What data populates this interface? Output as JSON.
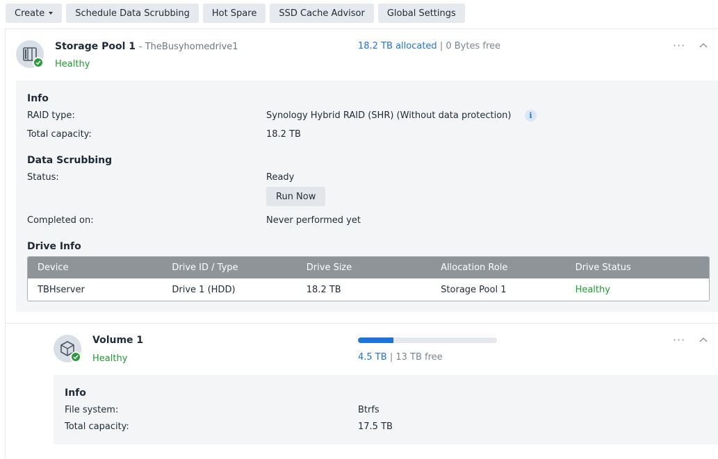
{
  "toolbar": {
    "create": "Create",
    "schedule": "Schedule Data Scrubbing",
    "hot_spare": "Hot Spare",
    "ssd_cache": "SSD Cache Advisor",
    "global_settings": "Global Settings"
  },
  "pool": {
    "name": "Storage Pool 1",
    "description": "- TheBusyhomedrive1",
    "status": "Healthy",
    "allocated": "18.2 TB allocated",
    "separator": "|",
    "free": "0 Bytes free",
    "more": "···",
    "info": {
      "heading": "Info",
      "raid_label": "RAID type:",
      "raid_value": "Synology Hybrid RAID (SHR) (Without data protection)",
      "info_glyph": "i",
      "capacity_label": "Total capacity:",
      "capacity_value": "18.2 TB"
    },
    "scrubbing": {
      "heading": "Data Scrubbing",
      "status_label": "Status:",
      "status_value": "Ready",
      "run_now": "Run Now",
      "completed_label": "Completed on:",
      "completed_value": "Never performed yet"
    },
    "drive_info": {
      "heading": "Drive Info",
      "columns": [
        "Device",
        "Drive ID / Type",
        "Drive Size",
        "Allocation Role",
        "Drive Status"
      ],
      "rows": [
        [
          "TBHserver",
          "Drive 1 (HDD)",
          "18.2 TB",
          "Storage Pool 1",
          "Healthy"
        ]
      ]
    }
  },
  "volume": {
    "name": "Volume 1",
    "status": "Healthy",
    "used": "4.5 TB",
    "separator": "|",
    "free": "13 TB free",
    "usage_fraction": 0.255,
    "more": "···",
    "info": {
      "heading": "Info",
      "fs_label": "File system:",
      "fs_value": "Btrfs",
      "capacity_label": "Total capacity:",
      "capacity_value": "17.5 TB"
    }
  },
  "colors": {
    "accent": "#2073d6",
    "healthy": "#1f9d2f",
    "table_header": "#8f9499"
  }
}
